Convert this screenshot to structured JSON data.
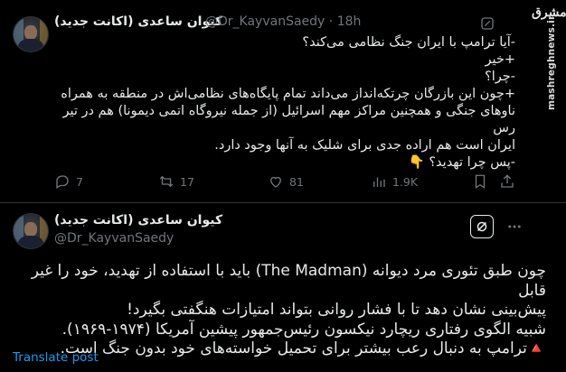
{
  "source_logo": {
    "text": "مشرق",
    "watermark": "mashreghnews.ir"
  },
  "retweet": {
    "author_name": "کیوان ساعدی (اکانت جدید)",
    "handle": "@Dr_KayvanSaedy",
    "separator": "·",
    "time": "18h",
    "text": "-آیا ترامپ با ایران جنگ نظامی می‌کند؟\n+خیر\n-چرا؟\n+چون این بازرگان چرتکه‌انداز می‌داند تمام پایگاه‌های نظامی‌اش در منطقه به همراه\nناوهای جنگی و همچنین مراکز مهم اسرائیل (از جمله نیروگاه اتمی دیمونا) هم در تیر رس\nایران است هم اراده جدی برای شلیک به آنها وجود دارد.\n-پس چرا تهدید؟ 👇",
    "actions": {
      "replies": "7",
      "retweets": "17",
      "likes": "81",
      "views": "1.9K"
    }
  },
  "main_tweet": {
    "author_name": "کیوان ساعدی (اکانت جدید)",
    "handle": "@Dr_KayvanSaedy",
    "text": "چون طبق تئوری مرد دیوانه (The Madman) باید با استفاده از تهدید، خود را غیر قابل\nپیش‌بینی نشان دهد تا با فشار روانی بتواند امتیازات هنگفتی بگیرد!\nشبیه الگوی رفتاری ریچارد نیکسون رئیس‌جمهور پیشین آمریکا (۱۹۷۴-۱۹۶۹).\n🔺ترامپ به دنبال رعب بیشتر برای تحمیل خواسته‌های خود بدون جنگ است.",
    "translate_label": "Translate post"
  },
  "icons": [
    "grok-icon",
    "more-icon",
    "reply-icon",
    "retweet-icon",
    "like-icon",
    "views-icon",
    "bookmark-icon",
    "share-icon"
  ],
  "colors": {
    "background": "#000000",
    "text": "#e7e9ea",
    "muted": "#71767b",
    "link": "#1d9bf0",
    "divider": "#2f3336"
  }
}
